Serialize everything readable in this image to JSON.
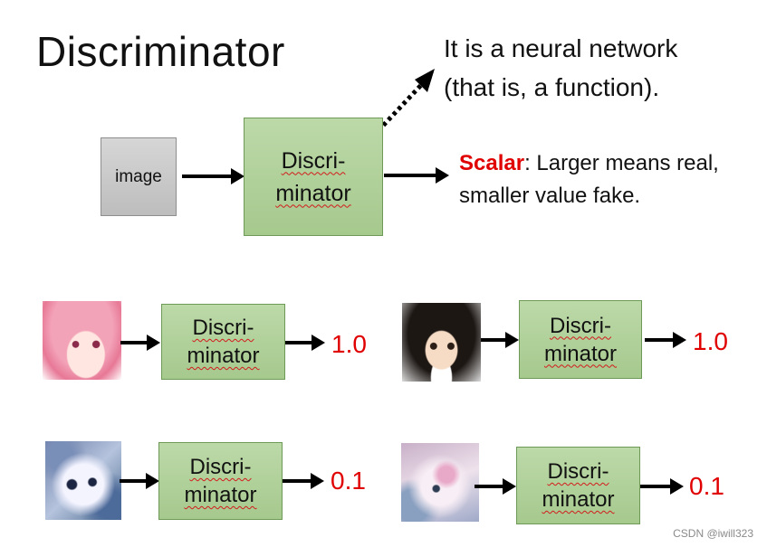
{
  "title": "Discriminator",
  "note": {
    "line1": "It is a neural network",
    "line2": "(that is, a function)."
  },
  "input_label": "image",
  "discriminator_label": {
    "line1": "Discri-",
    "line2": "minator"
  },
  "scalar_note": {
    "word": "Scalar",
    "rest": ": Larger means real,",
    "line2": "smaller value fake."
  },
  "examples": [
    {
      "image": "pink-haired anime face",
      "value": "1.0"
    },
    {
      "image": "dark-haired anime face",
      "value": "1.0"
    },
    {
      "image": "noisy generated face",
      "value": "0.1"
    },
    {
      "image": "noisy generated face",
      "value": "0.1"
    }
  ],
  "colors": {
    "discriminator_fill": "#a9cb92",
    "value_red": "#e00000",
    "image_box": "#c8c8c8"
  },
  "watermark": "CSDN @iwill323"
}
